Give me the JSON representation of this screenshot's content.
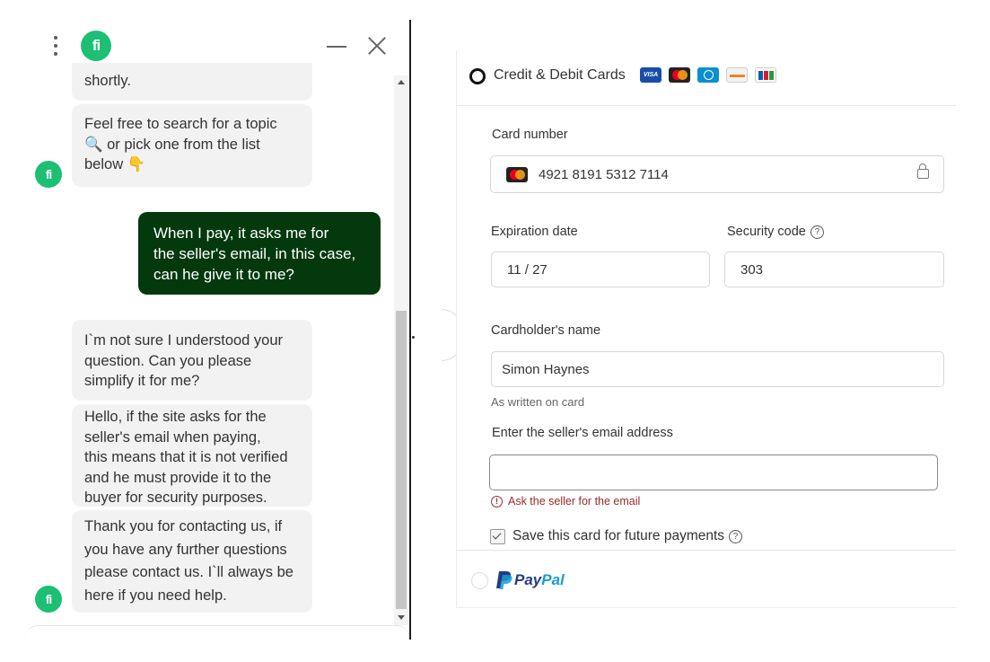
{
  "chat": {
    "logo_text": "fi",
    "messages": [
      {
        "from": "bot",
        "text": "shortly."
      },
      {
        "from": "bot",
        "text": "Feel free to search for a topic\n🔍 or pick one from the list\nbelow 👇"
      },
      {
        "from": "user",
        "text": "When I pay, it asks me for\nthe seller's email, in this case,\ncan he give it to me?"
      },
      {
        "from": "bot",
        "text": "I`m not sure I understood your\nquestion. Can you please\nsimplify it for me?"
      },
      {
        "from": "bot",
        "text": "Hello, if the site asks for the\nseller's email when paying,\nthis means that it is not verified\nand he must provide it to the\nbuyer for security purposes."
      },
      {
        "from": "bot",
        "text": "Thank you for contacting us, if\nyou have any further questions\nplease contact us. I`ll always be\nhere if you need help."
      }
    ]
  },
  "payment": {
    "method_label": "Credit & Debit Cards",
    "card_brands": [
      "VISA",
      "Mastercard",
      "Diners",
      "Discover",
      "JCB"
    ],
    "card_number_label": "Card number",
    "card_number_value": "4921 8191 5312 7114",
    "expiration_label": "Expiration date",
    "expiration_value": "11 / 27",
    "security_label": "Security code",
    "security_value": "303",
    "help_glyph": "?",
    "name_label": "Cardholder's name",
    "name_value": "Simon Haynes",
    "name_hint": "As written on card",
    "email_label": "Enter the seller's email address",
    "email_value": "",
    "email_error": "Ask the seller for the email",
    "save_card_label": "Save this card for future payments",
    "save_card_checked": true,
    "paypal_part1": "Pay",
    "paypal_part2": "Pal"
  },
  "colors": {
    "brand_green": "#1dbf73",
    "user_bubble": "#04390d",
    "error": "#9a2a2a"
  }
}
